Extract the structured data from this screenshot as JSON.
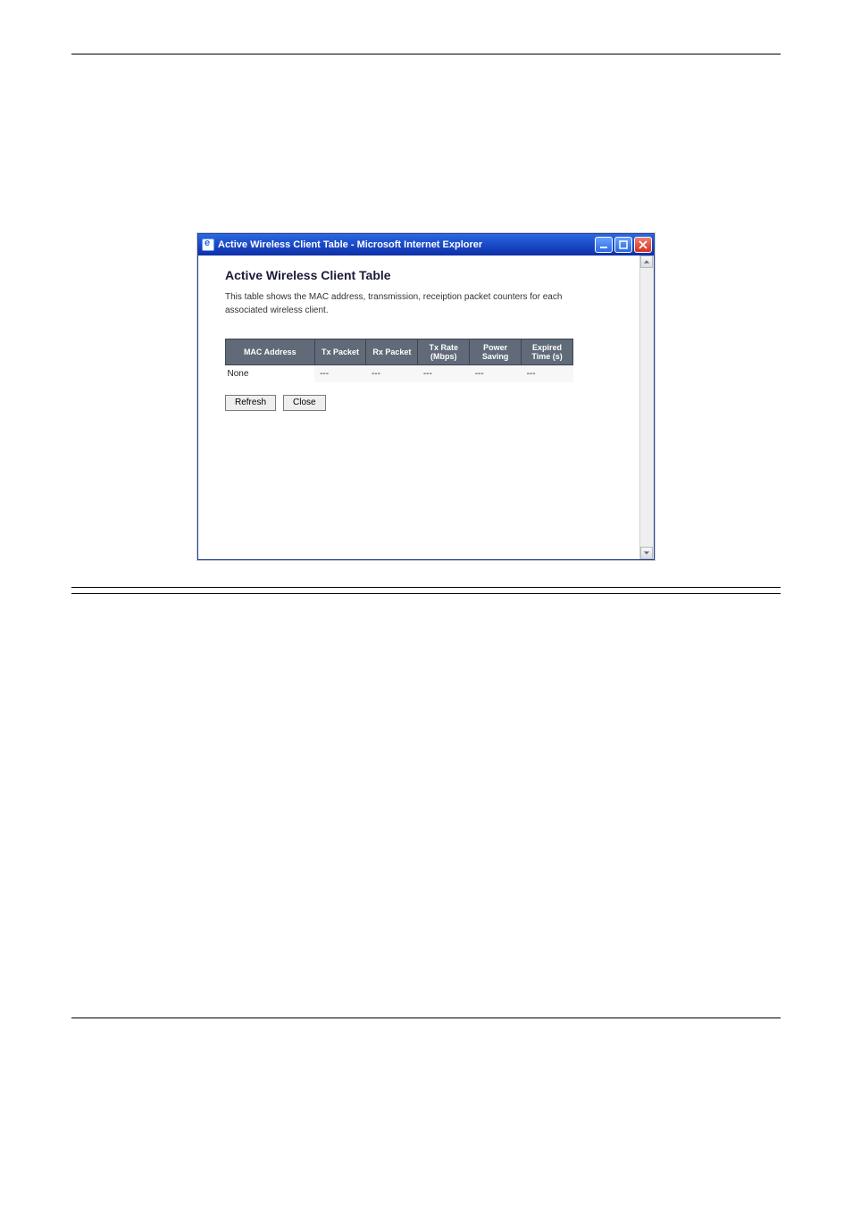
{
  "window": {
    "title": "Active Wireless Client Table - Microsoft Internet Explorer"
  },
  "panel": {
    "title": "Active Wireless Client Table",
    "description": "This table shows the MAC address, transmission, receiption packet counters for each associated wireless client."
  },
  "table": {
    "headers": [
      "MAC Address",
      "Tx Packet",
      "Rx Packet",
      "Tx Rate (Mbps)",
      "Power Saving",
      "Expired Time (s)"
    ],
    "row": {
      "mac": "None",
      "tx": "---",
      "rx": "---",
      "rate": "---",
      "power": "---",
      "exp": "---"
    }
  },
  "buttons": {
    "refresh": "Refresh",
    "close": "Close"
  }
}
